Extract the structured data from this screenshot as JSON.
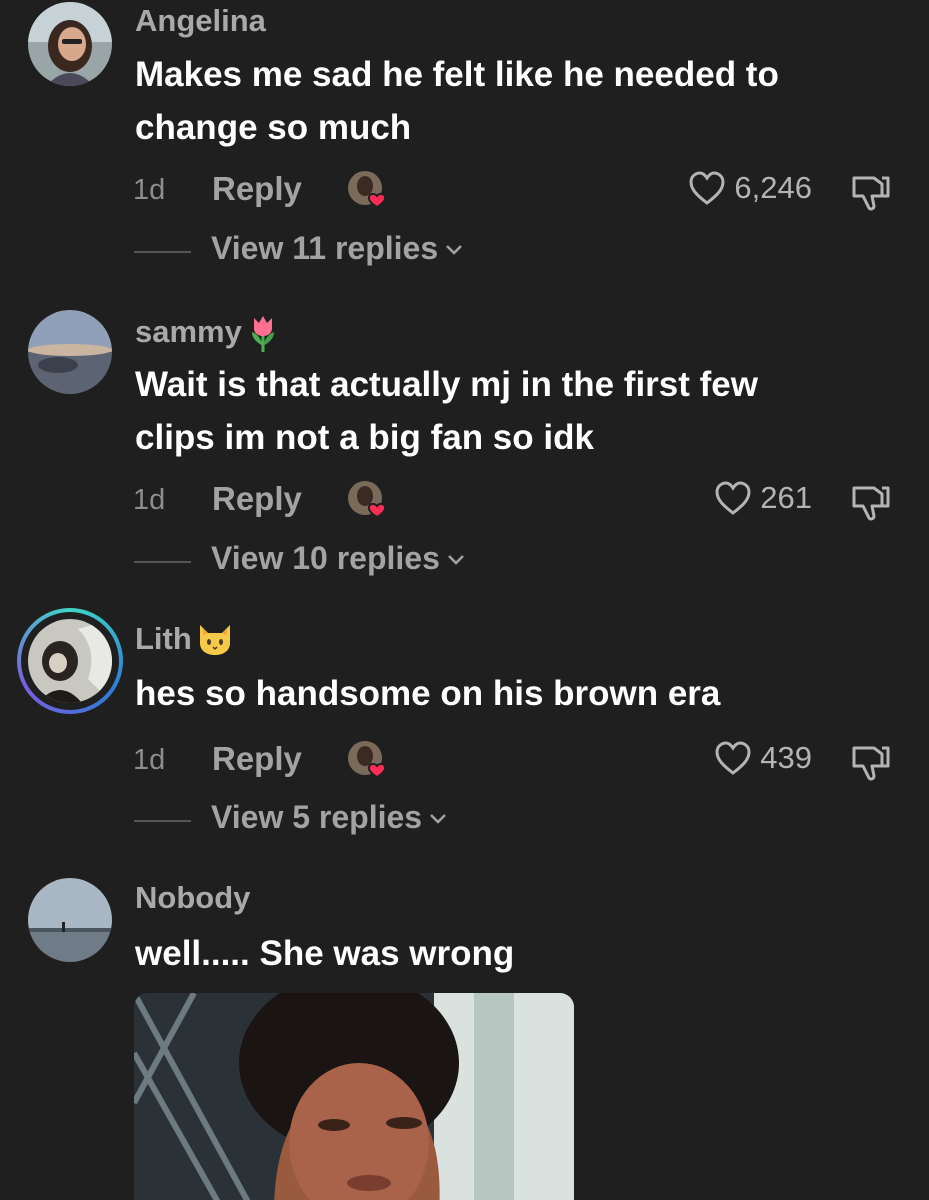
{
  "comments": [
    {
      "username": "Angelina",
      "text_lines": [
        "Makes me sad he felt like he needed to",
        "change so much"
      ],
      "time": "1d",
      "reply_label": "Reply",
      "likes": "6,246",
      "view_replies": "View 11 replies"
    },
    {
      "username": "sammy",
      "username_emoji": "tulip",
      "text_lines": [
        "Wait is that actually mj in the first few",
        "clips im not a big fan so idk"
      ],
      "time": "1d",
      "reply_label": "Reply",
      "likes": "261",
      "view_replies": "View 10 replies"
    },
    {
      "username": "Lith",
      "username_emoji": "cat-face",
      "text_lines": [
        "hes so handsome on his brown era"
      ],
      "time": "1d",
      "reply_label": "Reply",
      "likes": "439",
      "view_replies": "View 5 replies"
    },
    {
      "username": "Nobody",
      "text_lines": [
        "well..... She was wrong"
      ]
    }
  ],
  "colors": {
    "background": "#1f1f1f",
    "text": "#ffffff",
    "muted": "#a3a3a3",
    "heart": "#ff2d55",
    "story_ring": "#3fd6c5"
  },
  "icons": {
    "like": "heart-outline-icon",
    "dislike": "thumbs-down-icon",
    "expand": "chevron-down-icon",
    "creator_liked": "creator-liked-badge-icon"
  }
}
